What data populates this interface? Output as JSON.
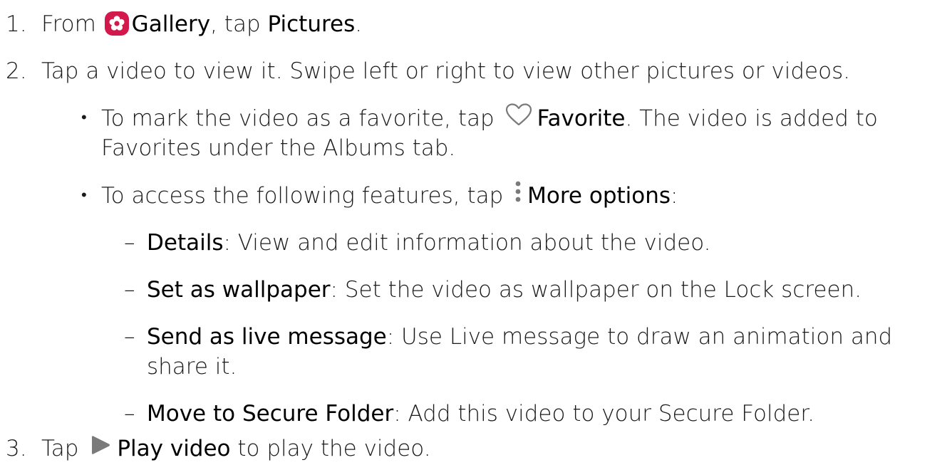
{
  "steps": [
    {
      "num": "1.",
      "pre": "From",
      "gallery_label": "Gallery",
      "mid": ", tap ",
      "pictures_label": "Pictures",
      "post": "."
    },
    {
      "num": "2.",
      "text": "Tap a video to view it. Swipe left or right to view other pictures or videos.",
      "favorite": {
        "pre": "To mark the video as a favorite, tap",
        "label": "Favorite",
        "post": ". The video is added to",
        "line2": "Favorites under the Albums tab."
      },
      "more_options": {
        "pre": "To access the following features, tap",
        "label": "More options",
        "post": ":",
        "items": [
          {
            "label": "Details",
            "desc": ": View and edit information about the video."
          },
          {
            "label": "Set as wallpaper",
            "desc": ": Set the video as wallpaper on the Lock screen."
          },
          {
            "label": "Send as live message",
            "desc": ": Use Live message to draw an animation and",
            "desc2": "share it."
          },
          {
            "label": "Move to Secure Folder",
            "desc": ": Add this video to your Secure Folder."
          }
        ]
      }
    },
    {
      "num": "3.",
      "pre": "Tap",
      "play_label": "Play video",
      "post": " to play the video."
    }
  ],
  "icons": {
    "gallery": "gallery-icon",
    "favorite": "heart-icon",
    "more": "more-options-icon",
    "play": "play-icon"
  },
  "colors": {
    "gallery_icon_bg": "#d3194c",
    "icon_gray": "#7a7a7a",
    "text": "#1a1a1a"
  }
}
